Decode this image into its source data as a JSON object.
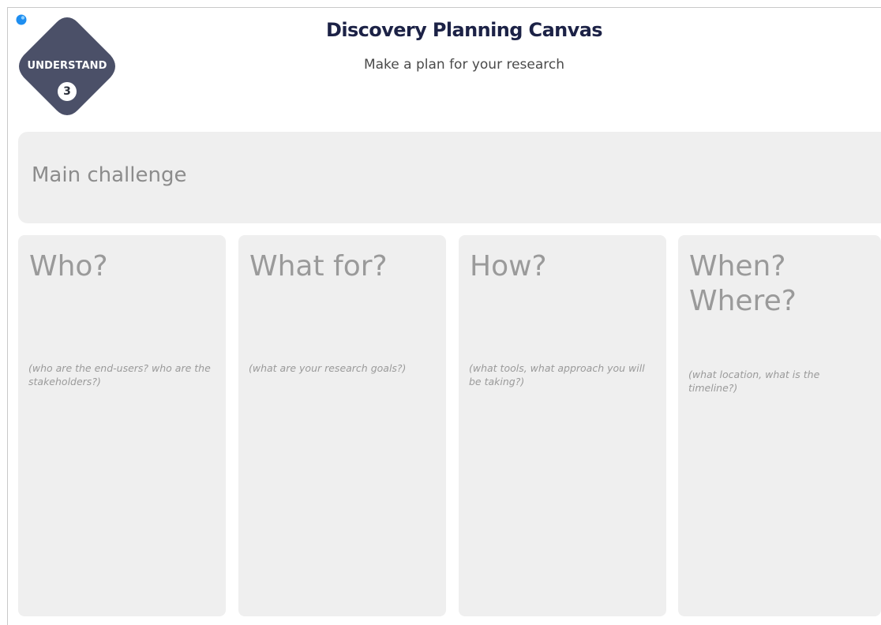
{
  "badge": {
    "label": "UNDERSTAND",
    "number": "3",
    "color": "#4b5068",
    "dot_color": "#1e8ef0"
  },
  "header": {
    "title": "Discovery Planning Canvas",
    "subtitle": "Make a plan for your research"
  },
  "challenge": {
    "label": "Main challenge"
  },
  "columns": [
    {
      "heading": "Who?",
      "hint": "(who are the end-users? who are the stakeholders?)"
    },
    {
      "heading": "What for?",
      "hint": "(what are your research goals?)"
    },
    {
      "heading": "How?",
      "hint": "(what tools, what approach you will be taking?)"
    },
    {
      "heading": "When? Where?",
      "hint": "(what location, what is the timeline?)"
    }
  ],
  "colors": {
    "panel": "#efefef",
    "title": "#1c2246",
    "placeholder": "#9a9a9a"
  }
}
